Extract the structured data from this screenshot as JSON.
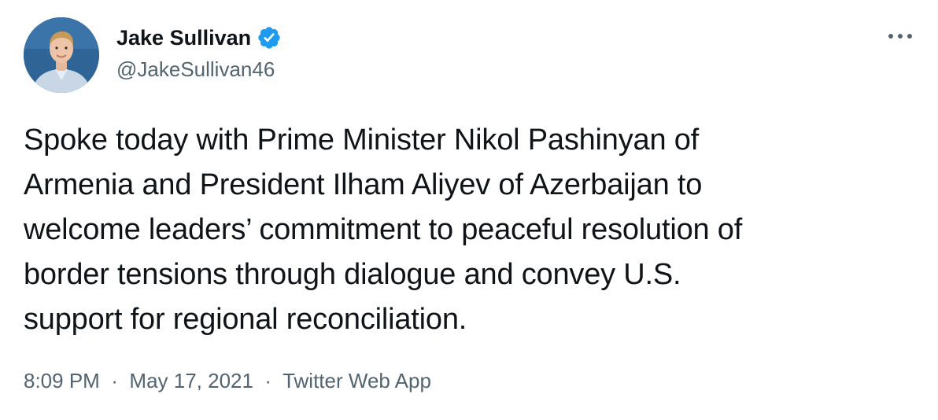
{
  "author": {
    "display_name": "Jake Sullivan",
    "handle": "@JakeSullivan46",
    "verified": true,
    "avatar_icon": "profile-photo"
  },
  "tweet": {
    "lines": [
      "Spoke today with Prime Minister Nikol Pashinyan of",
      "Armenia and President Ilham Aliyev of Azerbaijan to",
      "welcome leaders’ commitment to peaceful resolution of",
      "border tensions through dialogue and convey U.S.",
      "support for regional reconciliation."
    ],
    "time": "8:09 PM",
    "separator": "·",
    "date": "May 17, 2021",
    "source": "Twitter Web App"
  },
  "colors": {
    "verified_badge": "#1d9bf0",
    "text_primary": "#0f1419",
    "text_secondary": "#536471"
  },
  "icons": {
    "more": "more-horizontal-icon",
    "verified": "verified-badge-icon"
  }
}
